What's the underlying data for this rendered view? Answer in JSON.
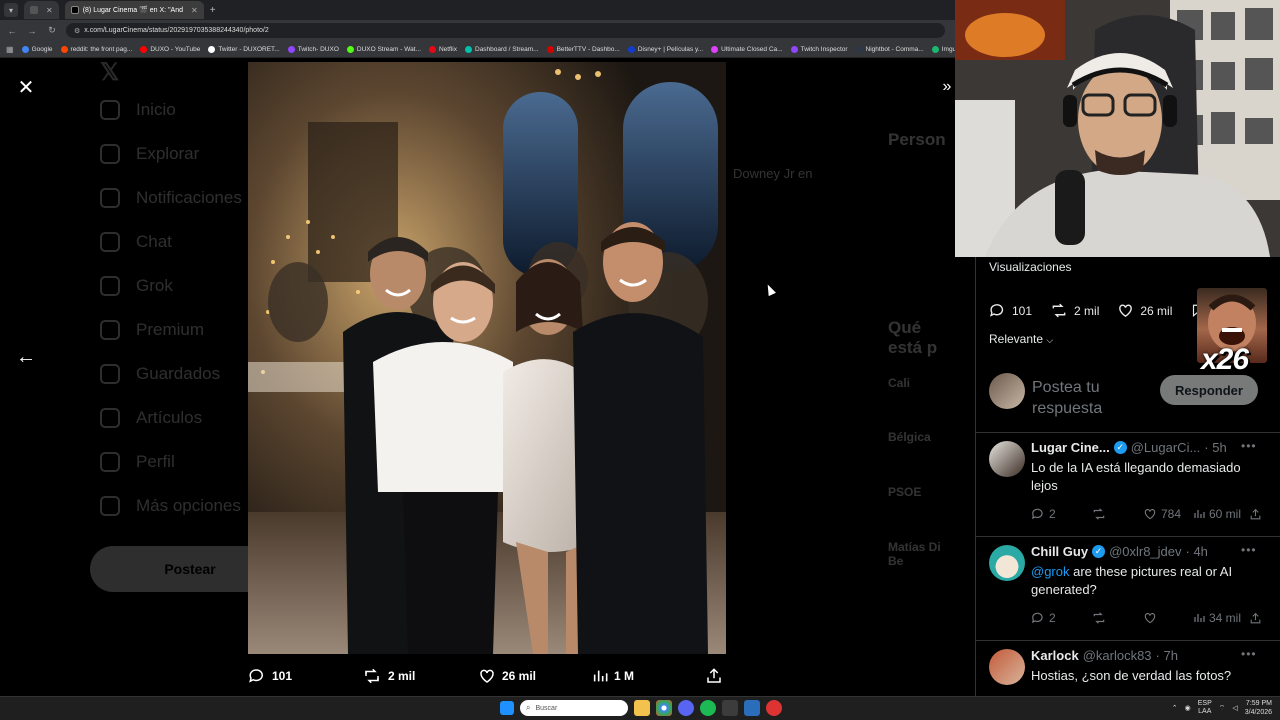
{
  "browser": {
    "tabs": [
      {
        "label": "(8) Lugar Cinema 🎬 en X: \"And",
        "active": true
      }
    ],
    "url": "x.com/LugarCinema/status/2029197035388244340/photo/2",
    "bookmarks": [
      {
        "label": "Google",
        "color": "#4285f4"
      },
      {
        "label": "reddit: the front pag...",
        "color": "#ff4500"
      },
      {
        "label": "DUXO - YouTube",
        "color": "#ff0000"
      },
      {
        "label": "Twitter - DUXORET...",
        "color": "#ffffff"
      },
      {
        "label": "Twitch- DUXO",
        "color": "#9146ff"
      },
      {
        "label": "DUXO Stream - Wat...",
        "color": "#53fc18"
      },
      {
        "label": "Netflix",
        "color": "#e50914"
      },
      {
        "label": "Dashboard / Stream...",
        "color": "#00c2a8"
      },
      {
        "label": "BetterTTV - Dashbo...",
        "color": "#d50000"
      },
      {
        "label": "Disney+ | Películas y...",
        "color": "#113ccf"
      },
      {
        "label": "Ultimate Closed Ca...",
        "color": "#e040fb"
      },
      {
        "label": "Twitch Inspector",
        "color": "#9146ff"
      },
      {
        "label": "Nightbot - Comma...",
        "color": "#2d3748"
      },
      {
        "label": "Imgur",
        "color": "#1bb76e"
      }
    ]
  },
  "background_sidebar": {
    "items": [
      "Inicio",
      "Explorar",
      "Notificaciones",
      "Chat",
      "Grok",
      "Premium",
      "Guardados",
      "Artículos",
      "Perfil",
      "Más opciones"
    ],
    "post_label": "Postear"
  },
  "background_right": {
    "snippet": "Downey Jr en",
    "people_heading": "Person",
    "trends_heading": "Qué está p",
    "trends": [
      "Cali",
      "Bélgica",
      "PSOE",
      "Matías Di Be"
    ]
  },
  "photo_actions": {
    "replies": "101",
    "reposts": "2 mil",
    "likes": "26 mil",
    "views": "1 M"
  },
  "panel": {
    "views_label": "Visualizaciones",
    "stats": {
      "replies": "101",
      "reposts": "2 mil",
      "likes": "26 mil"
    },
    "sort_label": "Relevante",
    "reply_placeholder": "Postea tu respuesta",
    "reply_button": "Responder",
    "meme_label": "x26",
    "replies": [
      {
        "name": "Lugar Cine...",
        "handle": "@LugarCi...",
        "time": "· 5h",
        "verified": true,
        "text_before": "",
        "mention": "",
        "text": "Lo de la IA está llegando demasiado lejos",
        "replies": "2",
        "reposts": "",
        "likes": "784",
        "views": "60 mil"
      },
      {
        "name": "Chill Guy",
        "handle": "@0xlr8_jdev",
        "time": "· 4h",
        "verified": true,
        "mention": "@grok",
        "text": " are these pictures real or AI generated?",
        "replies": "2",
        "reposts": "",
        "likes": "",
        "views": "34 mil"
      },
      {
        "name": "Karlock",
        "handle": "@karlock83",
        "time": "· 7h",
        "verified": false,
        "mention": "",
        "text": "Hostias, ¿son de verdad las fotos?",
        "replies": "",
        "reposts": "",
        "likes": "",
        "views": ""
      }
    ]
  },
  "taskbar": {
    "search_placeholder": "Buscar",
    "lang_top": "ESP",
    "lang_bottom": "LAA",
    "time": "7:59 PM",
    "date": "3/4/2026"
  }
}
